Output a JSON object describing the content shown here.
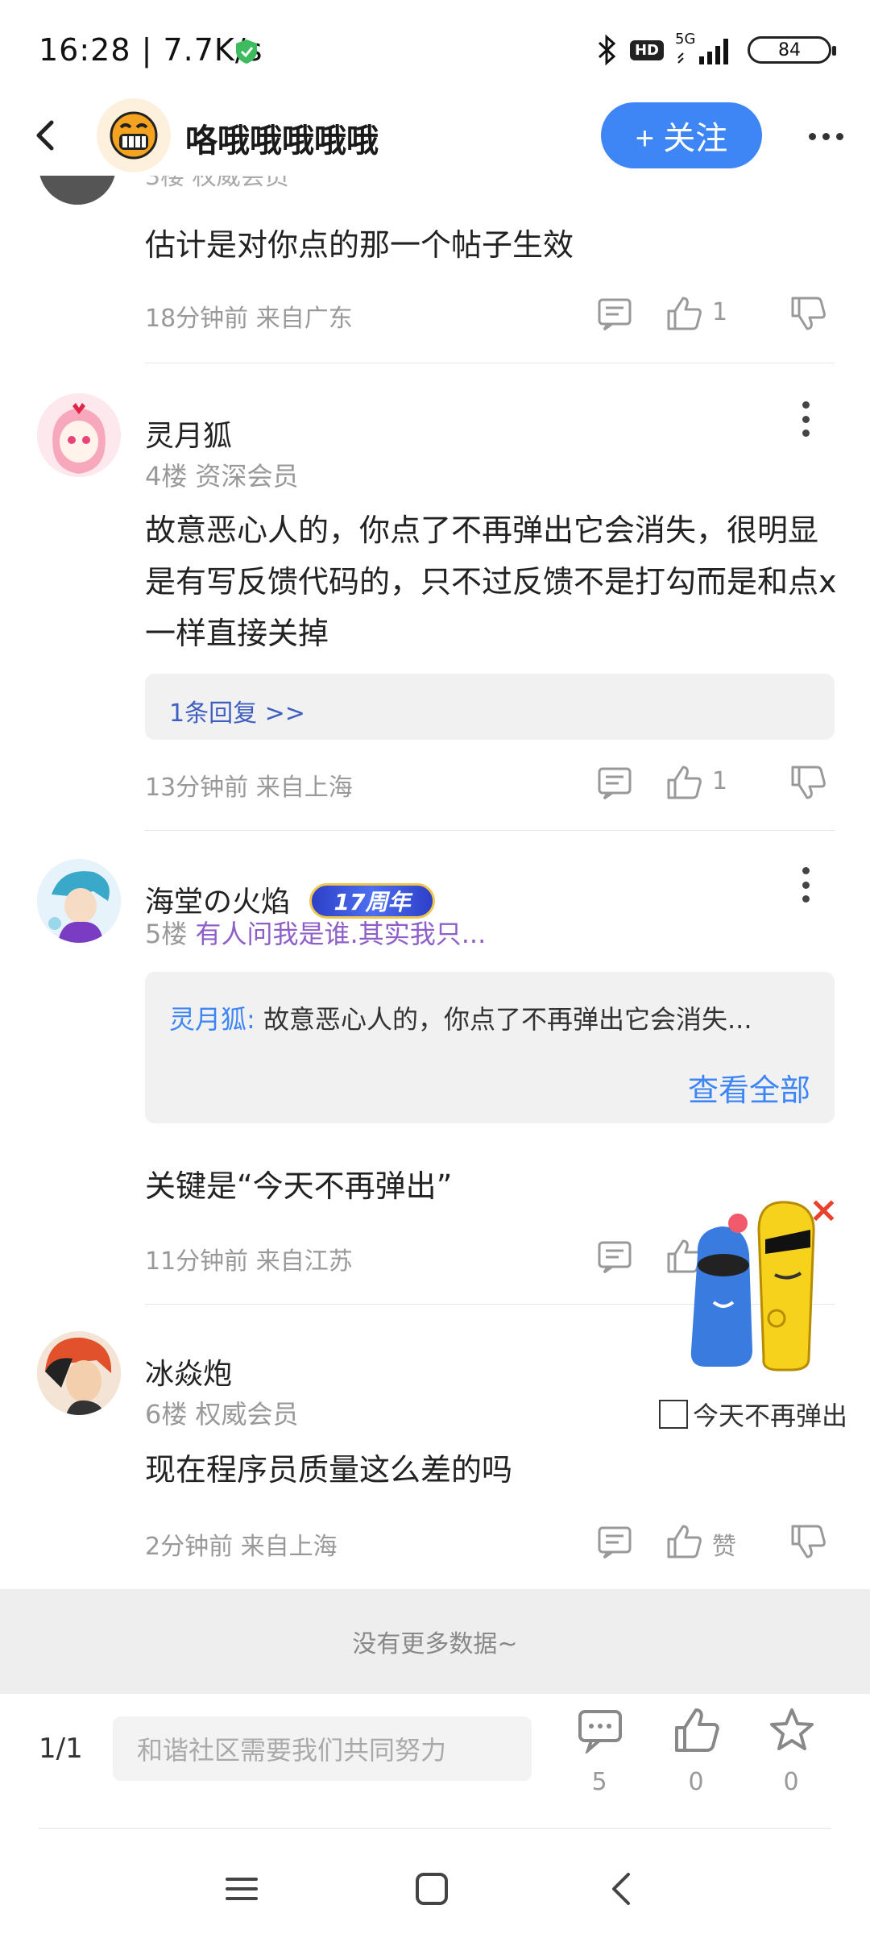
{
  "status_bar": {
    "time": "16:28",
    "net_speed": "| 7.7K/s",
    "hd": "HD",
    "network": "5G",
    "battery": "84",
    "colors": {
      "shield": "#3dbb5e"
    }
  },
  "header": {
    "title": "咯哦哦哦哦哦",
    "follow_label": "+ 关注",
    "colors": {
      "follow_bg": "#3e86f5"
    }
  },
  "partial_post": {
    "floor_meta": "3楼 权威会员",
    "text": "估计是对你点的那一个帖子生效",
    "time_location": "18分钟前 来自广东",
    "likes": "1"
  },
  "posts": [
    {
      "username": "灵月狐",
      "floor": "4楼",
      "rank": "资深会员",
      "text": "故意恶心人的，你点了不再弹出它会消失，很明显是有写反馈代码的，只不过反馈不是打勾而是和点x一样直接关掉",
      "reply_count": "1条回复 >>",
      "time_location": "13分钟前 来自上海",
      "likes": "1"
    },
    {
      "username": "海堂の火焰",
      "badge": "17周年",
      "floor": "5楼",
      "signature": "有人问我是谁.其实我只...",
      "quote_name": "灵月狐:",
      "quote_text": "故意恶心人的，你点了不再弹出它会消失...",
      "view_all": "查看全部",
      "text": "关键是“今天不再弹出”",
      "time_location": "11分钟前 来自江苏"
    },
    {
      "username": "冰焱炮",
      "floor": "6楼",
      "rank": "权威会员",
      "text": "现在程序员质量这么差的吗",
      "time_location": "2分钟前 来自上海",
      "likes": "赞"
    }
  ],
  "footer": {
    "no_more": "没有更多数据~"
  },
  "floating_ad": {
    "close": "×",
    "no_popup": "今天不再弹出"
  },
  "bottom_bar": {
    "page": "1/1",
    "input_placeholder": "和谐社区需要我们共同努力",
    "comments": "5",
    "likes": "0",
    "favorites": "0"
  },
  "icons": [
    "back-icon",
    "more-icon",
    "comment-icon",
    "thumb-up-icon",
    "thumb-down-icon",
    "kebab-icon",
    "star-icon",
    "menu-icon",
    "home-icon",
    "nav-back-icon",
    "bluetooth-icon",
    "signal-icon",
    "shield-icon"
  ]
}
